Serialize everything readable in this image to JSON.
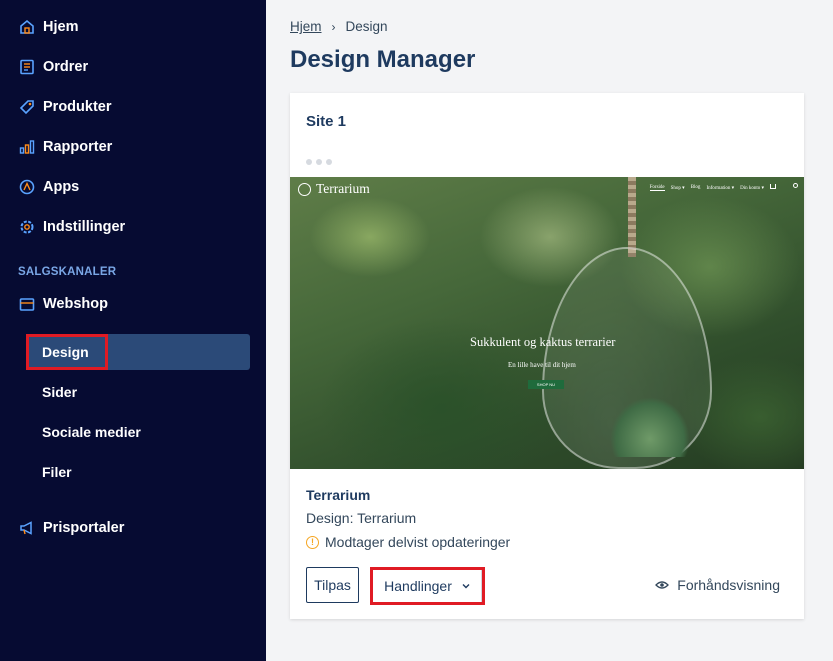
{
  "sidebar": {
    "nav": [
      {
        "label": "Hjem",
        "icon": "home-icon"
      },
      {
        "label": "Ordrer",
        "icon": "orders-icon"
      },
      {
        "label": "Produkter",
        "icon": "tag-icon"
      },
      {
        "label": "Rapporter",
        "icon": "bar-chart-icon"
      },
      {
        "label": "Apps",
        "icon": "apps-icon"
      },
      {
        "label": "Indstillinger",
        "icon": "gear-icon"
      }
    ],
    "section_label": "SALGSKANALER",
    "webshop_label": "Webshop",
    "sub_items": [
      "Design",
      "Sider",
      "Sociale medier",
      "Filer"
    ],
    "pris_label": "Prisportaler"
  },
  "breadcrumb": {
    "home": "Hjem",
    "current": "Design"
  },
  "page_title": "Design Manager",
  "card": {
    "site_title": "Site 1",
    "preview": {
      "logo": "Terrarium",
      "menu": [
        "Forside",
        "Shop ▾",
        "Blog",
        "Information ▾",
        "Din konto ▾"
      ],
      "headline": "Sukkulent og kaktus terrarier",
      "subline": "En lille have til dit hjem",
      "button": "SHOP NU"
    },
    "theme_name": "Terrarium",
    "design_line": "Design: Terrarium",
    "status": "Modtager delvist opdateringer",
    "tilpas": "Tilpas",
    "handlinger": "Handlinger",
    "preview_link": "Forhåndsvisning"
  },
  "colors": {
    "sidebar_bg": "#060b32",
    "active_item_bg": "#2b4a78",
    "highlight": "#e01b24",
    "title": "#1e3a5f",
    "warning": "#f5a623"
  }
}
